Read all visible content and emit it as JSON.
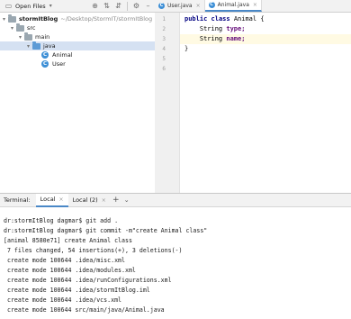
{
  "project_toolbar": {
    "open_files_label": "Open Files",
    "icons": [
      "open-files-icon",
      "target-icon",
      "expand-icon",
      "collapse-icon",
      "gear-icon",
      "minimize-icon"
    ]
  },
  "tree": {
    "items": [
      {
        "label": "stormItBlog",
        "path": "~/Desktop/StormIT/stormItBlog",
        "expanded": true
      },
      {
        "label": "src",
        "expanded": true
      },
      {
        "label": "main",
        "expanded": true
      },
      {
        "label": "java",
        "expanded": true,
        "selected": true
      },
      {
        "label": "Animal"
      },
      {
        "label": "User"
      }
    ]
  },
  "editor": {
    "tabs": [
      {
        "label": "User.java",
        "active": false
      },
      {
        "label": "Animal.java",
        "active": true
      }
    ],
    "line_numbers": [
      "1",
      "2",
      "3",
      "4",
      "5",
      "6"
    ],
    "lines": {
      "l1_kw1": "public",
      "l1_kw2": "class",
      "l1_name": "Animal {",
      "l2_type": "String",
      "l2_field": "type;",
      "l3_type": "String",
      "l3_field": "name;",
      "l4": "}"
    },
    "current_line": 3
  },
  "terminal": {
    "title": "Terminal:",
    "tabs": [
      {
        "label": "Local",
        "active": true
      },
      {
        "label": "Local (2)",
        "active": false
      }
    ],
    "add_symbol": "+",
    "menu_symbol": "⌄",
    "lines": [
      "dr:stormItBlog dagmar$ git add .",
      "dr:stormItBlog dagmar$ git commit -m\"create Animal class\"",
      "[animal 8580e71] create Animal class",
      " 7 files changed, 54 insertions(+), 3 deletions(-)",
      " create mode 100644 .idea/misc.xml",
      " create mode 100644 .idea/modules.xml",
      " create mode 100644 .idea/runConfigurations.xml",
      " create mode 100644 .idea/stormItBlog.iml",
      " create mode 100644 .idea/vcs.xml",
      " create mode 100644 src/main/java/Animal.java"
    ]
  },
  "colors": {
    "keyword": "#000080",
    "field": "#660e7a",
    "selection": "#d5e1f2",
    "current_line": "#fffae3",
    "active_tab_underline": "#4a88c7"
  }
}
